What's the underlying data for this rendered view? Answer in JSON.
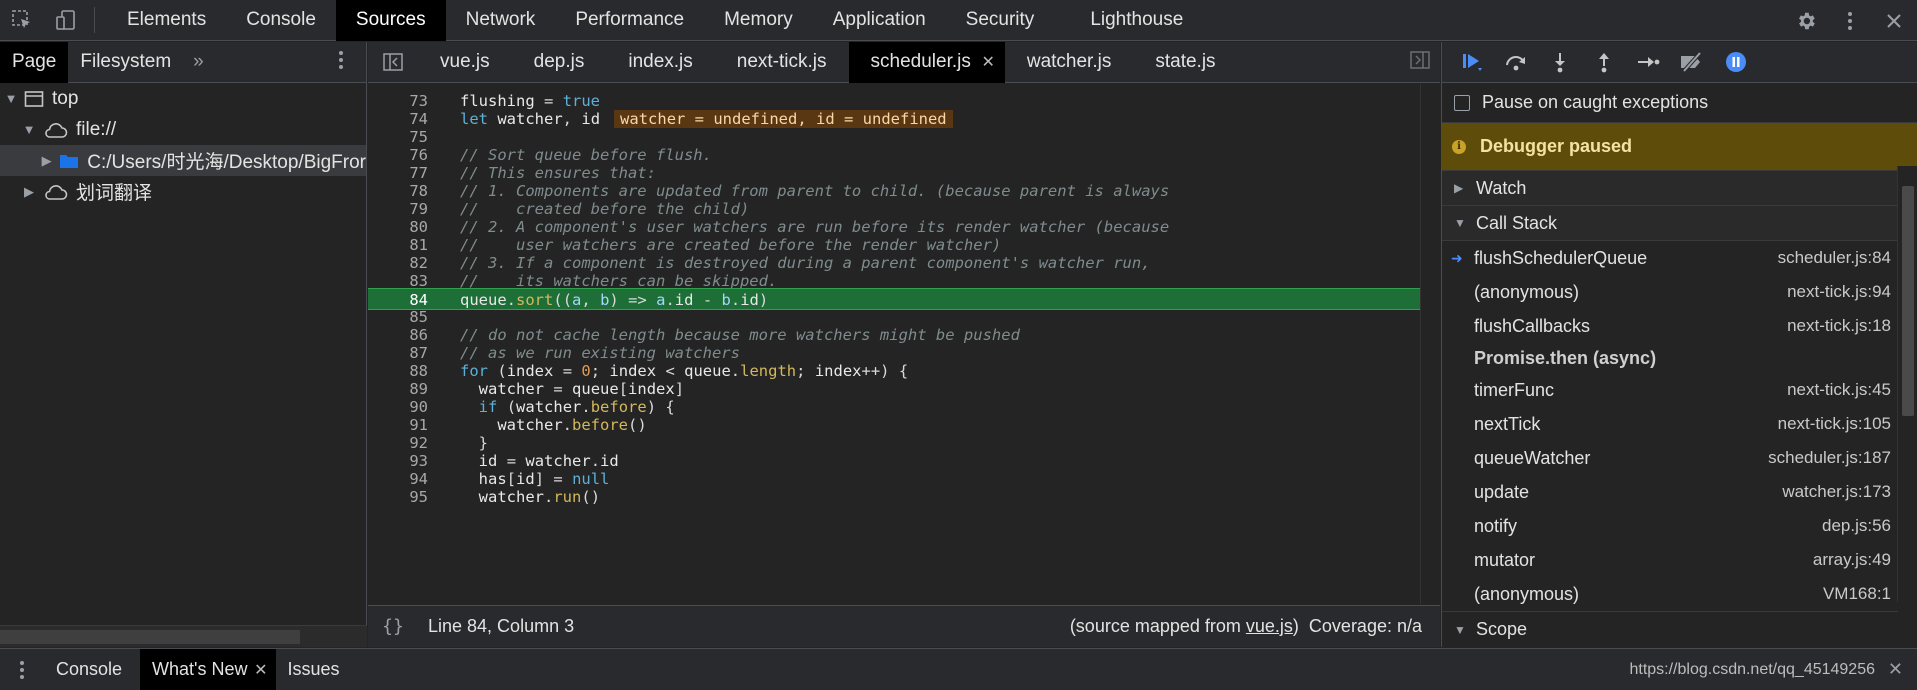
{
  "toolbar": {
    "tabs": [
      "Elements",
      "Console",
      "Sources",
      "Network",
      "Performance",
      "Memory",
      "Application",
      "Security",
      "Lighthouse"
    ],
    "active_tab": "Sources",
    "icons": [
      "inspect-element-icon",
      "device-toggle-icon",
      "settings-gear-icon",
      "more-options-icon",
      "close-devtools-icon"
    ]
  },
  "navigator": {
    "tabs": [
      "Page",
      "Filesystem"
    ],
    "active_tab": "Page",
    "more": "»",
    "tree": [
      {
        "label": "top",
        "icon": "frame-icon",
        "expanded": true
      },
      {
        "label": "file://",
        "icon": "cloud-icon",
        "expanded": true
      },
      {
        "label": "C:/Users/时光海/Desktop/BigFror",
        "icon": "folder-icon",
        "expanded": false,
        "selected": true
      },
      {
        "label": "划词翻译",
        "icon": "cloud-icon",
        "expanded": false
      }
    ]
  },
  "editor": {
    "files": [
      "vue.js",
      "dep.js",
      "index.js",
      "next-tick.js",
      "scheduler.js",
      "watcher.js",
      "state.js"
    ],
    "active_file": "scheduler.js",
    "inline_value": "watcher = undefined, id = undefined",
    "status": {
      "position": "Line 84, Column 3",
      "mapped_prefix": "(source mapped from ",
      "mapped_link": "vue.js",
      "mapped_suffix": ")",
      "coverage": "Coverage: n/a",
      "pretty_print": "{}"
    },
    "lines": [
      {
        "n": "73",
        "text": "  flushing = true"
      },
      {
        "n": "74",
        "text": "  let watcher, id"
      },
      {
        "n": "75",
        "text": ""
      },
      {
        "n": "76",
        "text": "  // Sort queue before flush."
      },
      {
        "n": "77",
        "text": "  // This ensures that:"
      },
      {
        "n": "78",
        "text": "  // 1. Components are updated from parent to child. (because parent is always"
      },
      {
        "n": "79",
        "text": "  //    created before the child)"
      },
      {
        "n": "80",
        "text": "  // 2. A component's user watchers are run before its render watcher (because"
      },
      {
        "n": "81",
        "text": "  //    user watchers are created before the render watcher)"
      },
      {
        "n": "82",
        "text": "  // 3. If a component is destroyed during a parent component's watcher run,"
      },
      {
        "n": "83",
        "text": "  //    its watchers can be skipped."
      },
      {
        "n": "84",
        "text": "  queue.sort((a, b) => a.id - b.id)"
      },
      {
        "n": "85",
        "text": ""
      },
      {
        "n": "86",
        "text": "  // do not cache length because more watchers might be pushed"
      },
      {
        "n": "87",
        "text": "  // as we run existing watchers"
      },
      {
        "n": "88",
        "text": "  for (index = 0; index < queue.length; index++) {"
      },
      {
        "n": "89",
        "text": "    watcher = queue[index]"
      },
      {
        "n": "90",
        "text": "    if (watcher.before) {"
      },
      {
        "n": "91",
        "text": "      watcher.before()"
      },
      {
        "n": "92",
        "text": "    }"
      },
      {
        "n": "93",
        "text": "    id = watcher.id"
      },
      {
        "n": "94",
        "text": "    has[id] = null"
      },
      {
        "n": "95",
        "text": "    watcher.run()"
      }
    ],
    "current_line": "84"
  },
  "debugger": {
    "buttons": [
      "resume-icon",
      "step-over-icon",
      "step-into-icon",
      "step-out-icon",
      "step-icon",
      "deactivate-breakpoints-icon",
      "pause-on-exceptions-icon"
    ],
    "pause_caught": "Pause on caught exceptions",
    "paused_banner": "Debugger paused",
    "watch": "Watch",
    "call_stack": "Call Stack",
    "frames": [
      {
        "name": "flushSchedulerQueue",
        "loc": "scheduler.js:84",
        "current": true
      },
      {
        "name": "(anonymous)",
        "loc": "next-tick.js:94"
      },
      {
        "name": "flushCallbacks",
        "loc": "next-tick.js:18"
      },
      {
        "name": "Promise.then (async)",
        "loc": "",
        "async": true
      },
      {
        "name": "timerFunc",
        "loc": "next-tick.js:45"
      },
      {
        "name": "nextTick",
        "loc": "next-tick.js:105"
      },
      {
        "name": "queueWatcher",
        "loc": "scheduler.js:187"
      },
      {
        "name": "update",
        "loc": "watcher.js:173"
      },
      {
        "name": "notify",
        "loc": "dep.js:56"
      },
      {
        "name": "mutator",
        "loc": "array.js:49"
      },
      {
        "name": "(anonymous)",
        "loc": "VM168:1"
      }
    ],
    "scope": "Scope"
  },
  "drawer": {
    "tabs": [
      "Console",
      "What's New",
      "Issues"
    ],
    "active_tab": "What's New",
    "url": "https://blog.csdn.net/qq_45149256"
  },
  "colors": {
    "active_tab_bg": "#000000",
    "exec_line_bg": "#1e6f37",
    "paused_banner_bg": "#5e4d0a",
    "accent_blue": "#4b8df8"
  }
}
